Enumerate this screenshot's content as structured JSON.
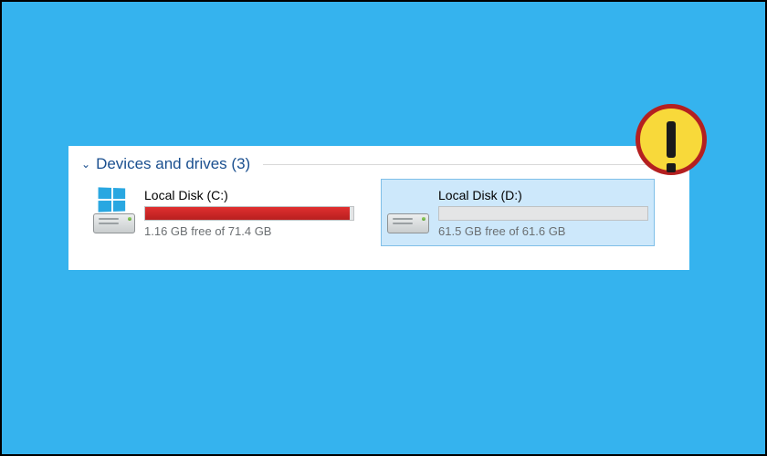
{
  "section": {
    "title": "Devices and drives (3)"
  },
  "drives": [
    {
      "label": "Local Disk (C:)",
      "free_text": "1.16 GB free of 71.4 GB",
      "used_percent": 98.4,
      "bar_color": "red",
      "system": true,
      "selected": false
    },
    {
      "label": "Local Disk (D:)",
      "free_text": "61.5 GB free of 61.6 GB",
      "used_percent": 0.2,
      "bar_color": "blue",
      "system": false,
      "selected": true
    }
  ],
  "alert": {
    "name": "warning-icon"
  },
  "colors": {
    "background": "#35b3ee",
    "bar_red": "#d12626",
    "bar_blue": "#2a8fd6",
    "selection": "#cde8fb"
  }
}
